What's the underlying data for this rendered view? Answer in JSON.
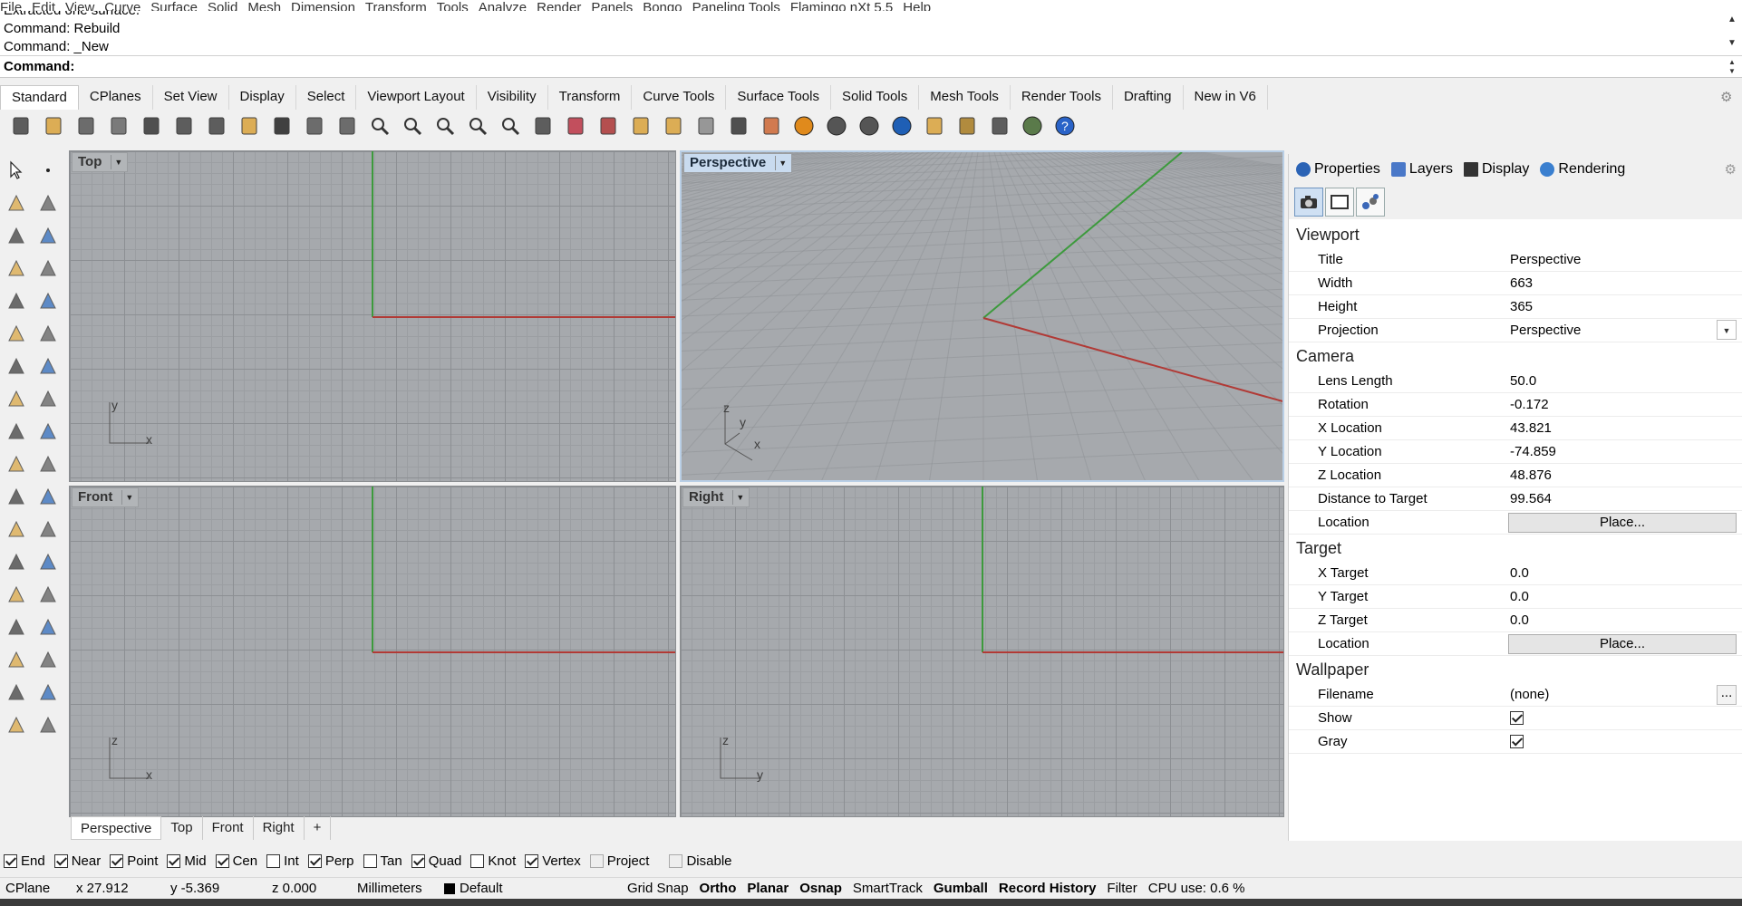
{
  "menu": [
    "File",
    "Edit",
    "View",
    "Curve",
    "Surface",
    "Solid",
    "Mesh",
    "Dimension",
    "Transform",
    "Tools",
    "Analyze",
    "Render",
    "Panels",
    "Bongo",
    "Paneling Tools",
    "Flamingo nXt 5.5",
    "Help"
  ],
  "command_history": [
    "Extracted one surface.",
    "Command: Rebuild",
    "Command: _New"
  ],
  "command_prompt": "Command:",
  "toolbar_tabs": [
    "Standard",
    "CPlanes",
    "Set View",
    "Display",
    "Select",
    "Viewport Layout",
    "Visibility",
    "Transform",
    "Curve Tools",
    "Surface Tools",
    "Solid Tools",
    "Mesh Tools",
    "Render Tools",
    "Drafting",
    "New in V6"
  ],
  "toolbar_icons": [
    "new-file-icon",
    "open-file-icon",
    "save-icon",
    "print-icon",
    "import-icon",
    "cut-icon",
    "copy-icon",
    "paste-icon",
    "undo-icon",
    "pan-icon",
    "rotate-view-icon",
    "zoom-icon",
    "zoom-window-icon",
    "zoom-extents-icon",
    "zoom-selected-icon",
    "zoom-dynamic-icon",
    "four-viewports-icon",
    "car-icon",
    "cplane-icon",
    "osnap-icon",
    "points-icon",
    "bulb-icon",
    "lock-icon",
    "layer-icon",
    "material-sphere-icon",
    "shaded-sphere-icon",
    "render-sphere-icon",
    "blue-sphere-icon",
    "filter-icon",
    "settings-gear-icon",
    "dimension-icon",
    "globe-icon",
    "help-icon"
  ],
  "viewports": {
    "top": {
      "title": "Top",
      "axis1": "y",
      "axis2": "x"
    },
    "perspective": {
      "title": "Perspective",
      "axis_z": "z",
      "axis_y": "y",
      "axis_x": "x"
    },
    "front": {
      "title": "Front",
      "axis1": "z",
      "axis2": "x"
    },
    "right": {
      "title": "Right",
      "axis1": "z",
      "axis2": "y"
    }
  },
  "viewport_tabs": [
    "Perspective",
    "Top",
    "Front",
    "Right",
    "+"
  ],
  "osnaps": [
    {
      "label": "End",
      "checked": true
    },
    {
      "label": "Near",
      "checked": true
    },
    {
      "label": "Point",
      "checked": true
    },
    {
      "label": "Mid",
      "checked": true
    },
    {
      "label": "Cen",
      "checked": true
    },
    {
      "label": "Int",
      "checked": false
    },
    {
      "label": "Perp",
      "checked": true
    },
    {
      "label": "Tan",
      "checked": false
    },
    {
      "label": "Quad",
      "checked": true
    },
    {
      "label": "Knot",
      "checked": false
    },
    {
      "label": "Vertex",
      "checked": true
    },
    {
      "label": "Project",
      "checked": false,
      "disabled": true
    },
    {
      "label": "Disable",
      "checked": false,
      "disabled": true
    }
  ],
  "status": {
    "cplane": "CPlane",
    "x": "x 27.912",
    "y": "y -5.369",
    "z": "z 0.000",
    "units": "Millimeters",
    "layer": "Default",
    "grid_snap": "Grid Snap",
    "ortho": "Ortho",
    "planar": "Planar",
    "osnap": "Osnap",
    "smarttrack": "SmartTrack",
    "gumball": "Gumball",
    "record_history": "Record History",
    "filter": "Filter",
    "cpu": "CPU use: 0.6 %"
  },
  "panel": {
    "tabs": [
      "Properties",
      "Layers",
      "Display",
      "Rendering"
    ],
    "sections": {
      "viewport": "Viewport",
      "camera": "Camera",
      "target": "Target",
      "wallpaper": "Wallpaper"
    },
    "viewport_rows": [
      {
        "k": "Title",
        "v": "Perspective"
      },
      {
        "k": "Width",
        "v": "663"
      },
      {
        "k": "Height",
        "v": "365"
      },
      {
        "k": "Projection",
        "v": "Perspective"
      }
    ],
    "camera_rows": [
      {
        "k": "Lens Length",
        "v": "50.0"
      },
      {
        "k": "Rotation",
        "v": "-0.172"
      },
      {
        "k": "X Location",
        "v": "43.821"
      },
      {
        "k": "Y Location",
        "v": "-74.859"
      },
      {
        "k": "Z Location",
        "v": "48.876"
      },
      {
        "k": "Distance to Target",
        "v": "99.564"
      },
      {
        "k": "Location",
        "v": "Place..."
      }
    ],
    "target_rows": [
      {
        "k": "X Target",
        "v": "0.0"
      },
      {
        "k": "Y Target",
        "v": "0.0"
      },
      {
        "k": "Z Target",
        "v": "0.0"
      },
      {
        "k": "Location",
        "v": "Place..."
      }
    ],
    "wallpaper_rows": [
      {
        "k": "Filename",
        "v": "(none)",
        "btn": "..."
      },
      {
        "k": "Show",
        "checked": true
      },
      {
        "k": "Gray",
        "checked": true
      }
    ]
  },
  "colors": {
    "x_axis": "#b13a36",
    "y_axis": "#3d9a3d",
    "viewport_bg": "#a6a9ad",
    "active_title": "#c9dbef"
  }
}
